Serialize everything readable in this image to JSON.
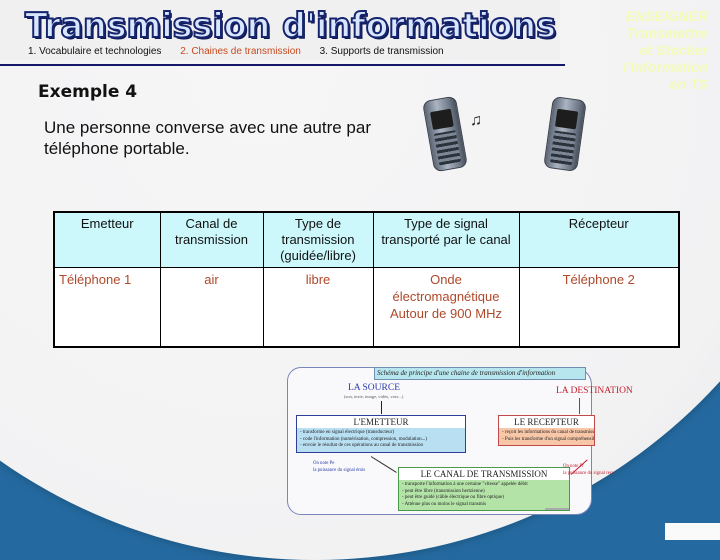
{
  "header": {
    "title": "Transmission d'informations",
    "nav": [
      {
        "label": "1. Vocabulaire et technologies",
        "active": false
      },
      {
        "label": "2. Chaines de transmission",
        "active": true
      },
      {
        "label": "3. Supports de transmission",
        "active": false
      }
    ],
    "brand_lines": [
      "ENSEIGNER",
      "Transmettre",
      "et Stocker",
      "l'Information",
      "en TS"
    ]
  },
  "colors": {
    "background_blue": "#246aa0",
    "title_fill": "#d8e6ff",
    "title_outline": "#16246e",
    "nav_active": "#c84a1e",
    "brand_text": "#f3fbb4",
    "table_header_bg": "#ccf8fc",
    "table_value_text": "#b0482a"
  },
  "example": {
    "title": "Exemple 4",
    "description": "Une personne converse avec une autre par téléphone portable.",
    "icons": [
      "mobile-phone-icon",
      "music-note-icon",
      "mobile-phone-icon"
    ],
    "note_glyph": "♫"
  },
  "table": {
    "headers": [
      "Emetteur",
      "Canal de transmission",
      "Type de transmission (guidée/libre)",
      "Type de signal transporté par le canal",
      "Récepteur"
    ],
    "row": [
      "Téléphone 1",
      "air",
      "libre",
      "Onde électromagnétique Autour de 900 MHz",
      "Téléphone 2"
    ]
  },
  "diagram": {
    "caption": "Schéma de principe d'une chaine de transmission d'information",
    "source_title": "LA SOURCE",
    "source_subtitle": "(son, texte, image, vidéo, voix...)",
    "destination_title": "LA DESTINATION",
    "emitter": {
      "title": "L'EMETTEUR",
      "lines": [
        "- transforme en signal électrique (transducteur)",
        "- code l'information (numérisation, compression, modulation...)",
        "- envoie le résultat de ces opérations au canal de transmission"
      ]
    },
    "receiver": {
      "title": "LE RECEPTEUR",
      "lines": [
        "- reçoit les informations du canal de transmission décode l'information",
        "- Puis les transforme d'un signal compréhensible par le destinataire"
      ]
    },
    "canal": {
      "title": "LE CANAL DE TRANSMISSION",
      "lines": [
        "- transporte l'information à une certaine \"vitesse\" appelée débit",
        "- peut être libre (transmission hertzienne)",
        "- peut être guidé (câble électrique ou fibre optique)",
        "- Atténue plus ou moins le signal transmis"
      ]
    },
    "note_left": [
      "On note Pe",
      "la puissance du signal émis"
    ],
    "note_right": [
      "On note Pr",
      "la puissance du signal reçu"
    ]
  }
}
